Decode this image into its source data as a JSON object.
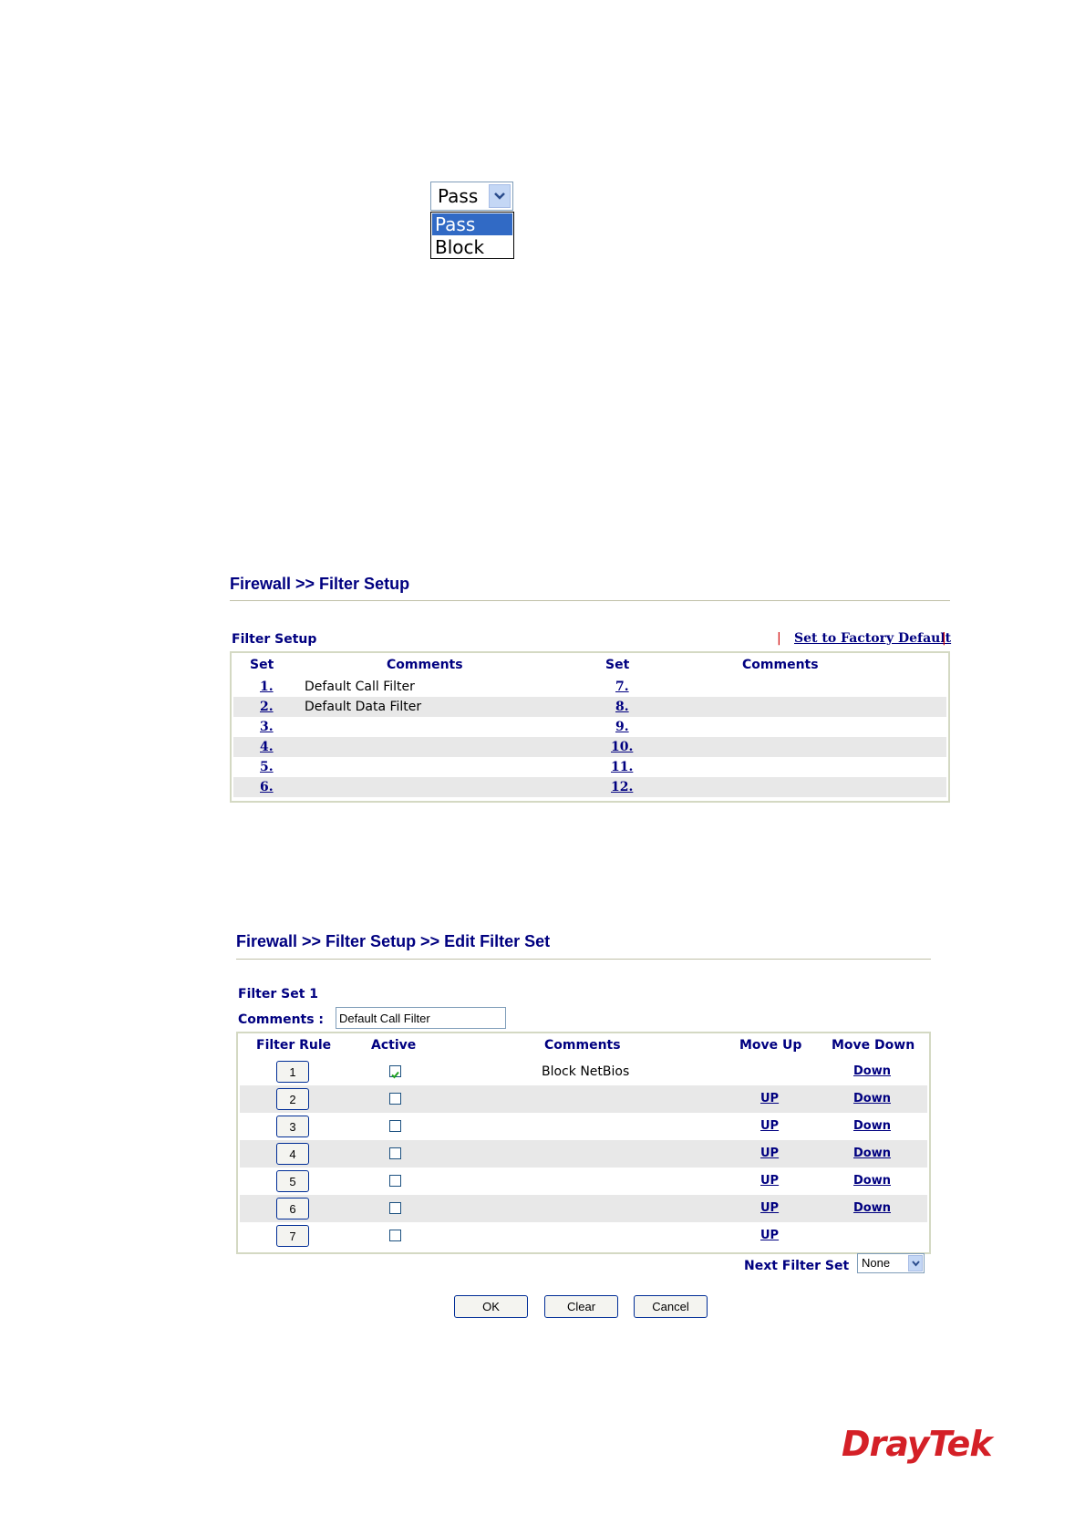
{
  "dropdown_example": {
    "selected": "Pass",
    "options": [
      "Pass",
      "Block"
    ]
  },
  "filter_setup_page": {
    "breadcrumb": "Firewall >> Filter Setup",
    "section_title": "Filter Setup",
    "factory_default_link": "Set to Factory Default",
    "separator": "|",
    "columns": [
      "Set",
      "Comments",
      "Set",
      "Comments"
    ],
    "left_sets": [
      {
        "set": "1.",
        "comment": "Default Call Filter"
      },
      {
        "set": "2.",
        "comment": "Default Data Filter"
      },
      {
        "set": "3.",
        "comment": ""
      },
      {
        "set": "4.",
        "comment": ""
      },
      {
        "set": "5.",
        "comment": ""
      },
      {
        "set": "6.",
        "comment": ""
      }
    ],
    "right_sets": [
      {
        "set": "7.",
        "comment": ""
      },
      {
        "set": "8.",
        "comment": ""
      },
      {
        "set": "9.",
        "comment": ""
      },
      {
        "set": "10.",
        "comment": ""
      },
      {
        "set": "11.",
        "comment": ""
      },
      {
        "set": "12.",
        "comment": ""
      }
    ]
  },
  "edit_filter_set_page": {
    "breadcrumb": "Firewall >> Filter Setup >> Edit Filter Set",
    "filter_set_label": "Filter Set 1",
    "comments_label": "Comments :",
    "comments_value": "Default Call Filter",
    "columns": [
      "Filter Rule",
      "Active",
      "Comments",
      "Move Up",
      "Move Down"
    ],
    "rules": [
      {
        "num": "1",
        "active": true,
        "comment": "Block NetBios",
        "up": "",
        "down": "Down"
      },
      {
        "num": "2",
        "active": false,
        "comment": "",
        "up": "UP",
        "down": "Down"
      },
      {
        "num": "3",
        "active": false,
        "comment": "",
        "up": "UP",
        "down": "Down"
      },
      {
        "num": "4",
        "active": false,
        "comment": "",
        "up": "UP",
        "down": "Down"
      },
      {
        "num": "5",
        "active": false,
        "comment": "",
        "up": "UP",
        "down": "Down"
      },
      {
        "num": "6",
        "active": false,
        "comment": "",
        "up": "UP",
        "down": "Down"
      },
      {
        "num": "7",
        "active": false,
        "comment": "",
        "up": "UP",
        "down": ""
      }
    ],
    "next_filter_set_label": "Next Filter Set",
    "next_filter_set_value": "None",
    "buttons": {
      "ok": "OK",
      "clear": "Clear",
      "cancel": "Cancel"
    }
  },
  "brand": {
    "logo_text": "DrayTek",
    "color": "#d42027"
  },
  "colors": {
    "nav_blue": "#000080",
    "row_alt": "#e8e8e8",
    "highlight": "#316ac5"
  }
}
